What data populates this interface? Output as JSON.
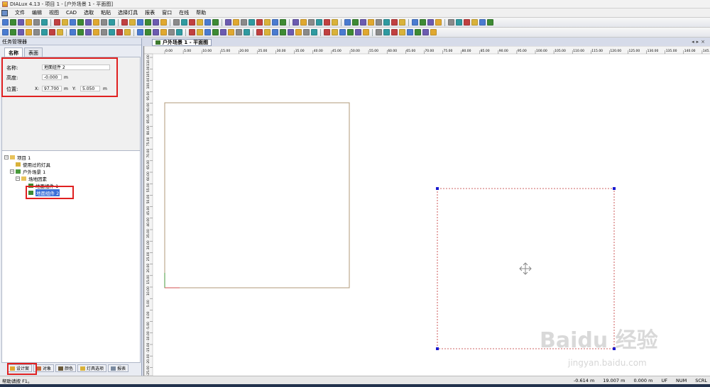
{
  "window": {
    "title": "DIALux 4.13 - 项目 1 - [户外场景 1 - 平面图]"
  },
  "menu": [
    "文件",
    "编辑",
    "视图",
    "CAD",
    "选取",
    "粘贴",
    "选择灯具",
    "报表",
    "窗口",
    "在线",
    "帮助"
  ],
  "task_manager": {
    "title": "任务管理器",
    "tabs": [
      "名称",
      "表面"
    ],
    "props": {
      "name_label": "名称:",
      "name_value": "地面组件 2",
      "height_label": "高度:",
      "height_value": "-0.000",
      "height_unit": "m",
      "pos_label": "位置:",
      "x_label": "X:",
      "x_value": "97.700",
      "x_unit": "m",
      "y_label": "Y:",
      "y_value": "5.050",
      "y_unit": "m"
    }
  },
  "tree": [
    {
      "label": "项目 1",
      "icon": "folder-icon"
    },
    {
      "label": "使用过的灯具",
      "icon": "luminaire-icon"
    },
    {
      "label": "户外场景 1",
      "icon": "scene-icon"
    },
    {
      "label": "场地因素",
      "icon": "folder-icon"
    },
    {
      "label": "地面组件 1",
      "icon": "ground-icon"
    },
    {
      "label": "地面组件 2",
      "icon": "ground-icon"
    }
  ],
  "bottom_tabs": [
    "设计案",
    "对象",
    "颜色",
    "灯具选项",
    "报表"
  ],
  "doc_tab": {
    "label": "户外场景 1 - 平面图"
  },
  "ruler": {
    "top_ticks": [
      "0.00",
      "5.00",
      "10.00",
      "15.00",
      "20.00",
      "25.00",
      "30.00",
      "35.00",
      "40.00",
      "45.00",
      "50.00",
      "55.00",
      "60.00",
      "65.00",
      "70.00",
      "75.00",
      "80.00",
      "85.00",
      "90.00",
      "95.00",
      "100.00",
      "105.00",
      "110.00",
      "115.00",
      "120.00",
      "125.00",
      "130.00",
      "135.00",
      "140.00",
      "145."
    ],
    "left_ticks": [
      "110.00",
      "105.00",
      "100.00",
      "95.00",
      "90.00",
      "85.00",
      "80.00",
      "75.00",
      "70.00",
      "65.00",
      "60.00",
      "55.00",
      "50.00",
      "45.00",
      "40.00",
      "35.00",
      "30.00",
      "25.00",
      "20.00",
      "15.00",
      "10.00",
      "5.00",
      "0.00",
      "-5.00",
      "-10.00",
      "-15.00",
      "-20.00",
      "-25.00"
    ]
  },
  "status": {
    "help": "帮助请按 F1。",
    "x_coord": "-0.614 m",
    "y_coord": "19.007 m",
    "z_coord": "0.000 m",
    "flags": [
      "UF",
      "NUM",
      "SCRL"
    ]
  },
  "watermark": {
    "text": "Baidu 经验",
    "sub": "jingyan.baidu.com"
  },
  "colors": {
    "selection_red": "#e02020",
    "selection_blue": "#1a1ad0",
    "tree_selected": "#3a6fd8",
    "shape_outline": "#b09a78"
  }
}
